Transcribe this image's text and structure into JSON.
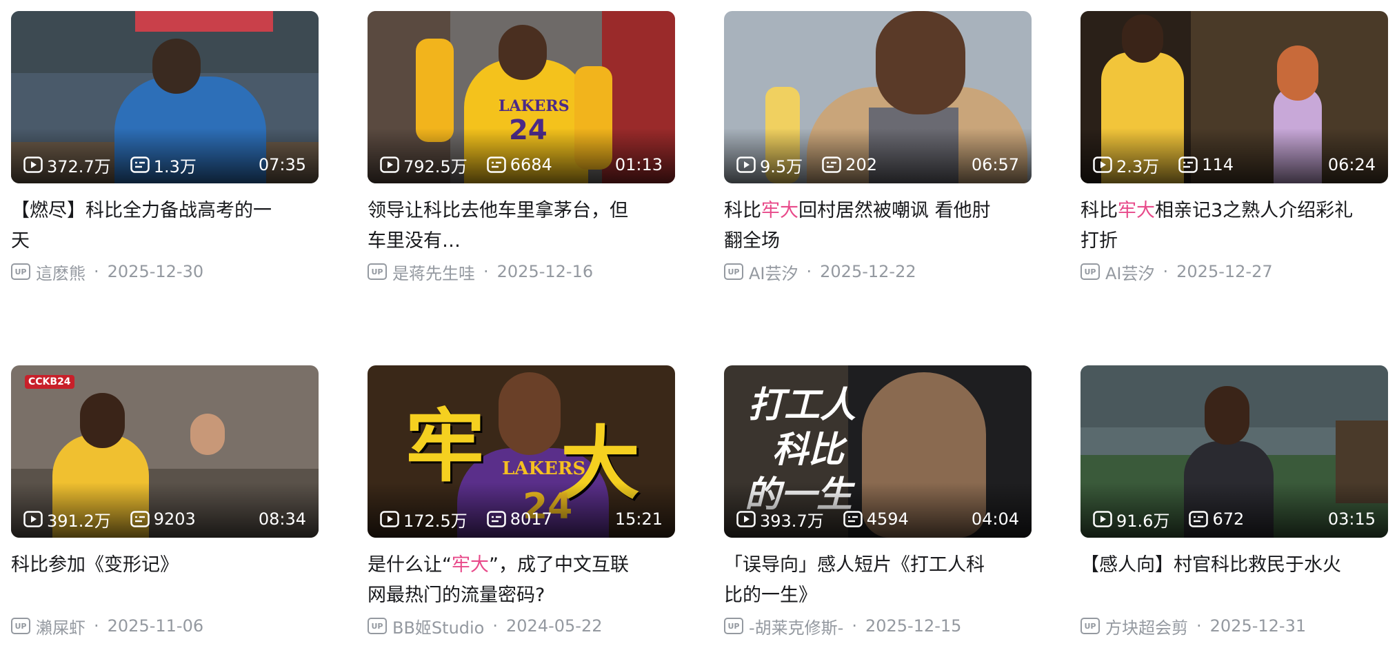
{
  "videos": [
    {
      "stats": {
        "views": "372.7万",
        "danmaku": "1.3万",
        "duration": "07:35"
      },
      "title_parts": [
        {
          "text": "【燃尽】科比全力备战高考的一天",
          "hl": false
        }
      ],
      "author": "這麽熊",
      "date": "2025-12-30",
      "thumb": {
        "bg": "#4a5a6a",
        "accent": "#2d6fb8",
        "floor": "#6b5a48"
      }
    },
    {
      "stats": {
        "views": "792.5万",
        "danmaku": "6684",
        "duration": "01:13"
      },
      "title_parts": [
        {
          "text": "领导让科比去他车里拿茅台，但车里没有…",
          "hl": false
        }
      ],
      "author": "是蒋先生哇",
      "date": "2025-12-16",
      "thumb": {
        "bg": "#6e6a68",
        "accent": "#f2b41c",
        "floor": "#8a7a70"
      }
    },
    {
      "stats": {
        "views": "9.5万",
        "danmaku": "202",
        "duration": "06:57"
      },
      "title_parts": [
        {
          "text": "科比",
          "hl": false
        },
        {
          "text": "牢大",
          "hl": true
        },
        {
          "text": "回村居然被嘲讽 看他肘翻全场",
          "hl": false
        }
      ],
      "author": "AI芸汐",
      "date": "2025-12-22",
      "thumb": {
        "bg": "#a8b2bc",
        "accent": "#c9a57a",
        "floor": "#6a6a72"
      }
    },
    {
      "stats": {
        "views": "2.3万",
        "danmaku": "114",
        "duration": "06:24"
      },
      "title_parts": [
        {
          "text": "科比",
          "hl": false
        },
        {
          "text": "牢大",
          "hl": true
        },
        {
          "text": "相亲记3之熟人介绍彩礼打折",
          "hl": false
        }
      ],
      "author": "AI芸汐",
      "date": "2025-12-27",
      "thumb": {
        "bg": "#4a3a28",
        "accent": "#f2c53a",
        "floor": "#c8a8d8"
      }
    },
    {
      "stats": {
        "views": "391.2万",
        "danmaku": "9203",
        "duration": "08:34"
      },
      "title_parts": [
        {
          "text": "科比参加《变形记》",
          "hl": false
        }
      ],
      "author": "瀨屎虾",
      "date": "2025-11-06",
      "thumb": {
        "bg": "#7a7068",
        "accent": "#f0c030",
        "floor": "#5a524a"
      }
    },
    {
      "stats": {
        "views": "172.5万",
        "danmaku": "8017",
        "duration": "15:21"
      },
      "title_parts": [
        {
          "text": "是什么让“",
          "hl": false
        },
        {
          "text": "牢大",
          "hl": true
        },
        {
          "text": "”，成了中文互联网最热门的流量密码?",
          "hl": false
        }
      ],
      "author": "BB姬Studio",
      "date": "2024-05-22",
      "thumb": {
        "bg": "#3a2818",
        "accent": "#5a2f8a",
        "floor": "#f5d020"
      }
    },
    {
      "stats": {
        "views": "393.7万",
        "danmaku": "4594",
        "duration": "04:04"
      },
      "title_parts": [
        {
          "text": "「误导向」感人短片《打工人科比的一生》",
          "hl": false
        }
      ],
      "author": "-胡莱克修斯-",
      "date": "2025-12-15",
      "thumb": {
        "bg": "#3a342e",
        "accent": "#8a6a50",
        "floor": "#1e1e20"
      }
    },
    {
      "stats": {
        "views": "91.6万",
        "danmaku": "672",
        "duration": "03:15"
      },
      "title_parts": [
        {
          "text": "【感人向】村官科比救民于水火",
          "hl": false
        }
      ],
      "author": "方块超会剪",
      "date": "2025-12-31",
      "thumb": {
        "bg": "#5a6a6e",
        "accent": "#2a2a30",
        "floor": "#3a5a3a"
      }
    }
  ],
  "labels": {
    "up_badge": "UP",
    "dot": "·"
  },
  "thumb_text": {
    "v6_big_left": "牢",
    "v6_big_right": "大",
    "v6_jersey": "LAKERS",
    "v6_number": "24",
    "v7_line1": "打工人",
    "v7_line2": "科比",
    "v7_line3": "的一生",
    "v2_jersey": "LAKERS",
    "v2_number": "24",
    "v5_logo": "CCKB24"
  }
}
